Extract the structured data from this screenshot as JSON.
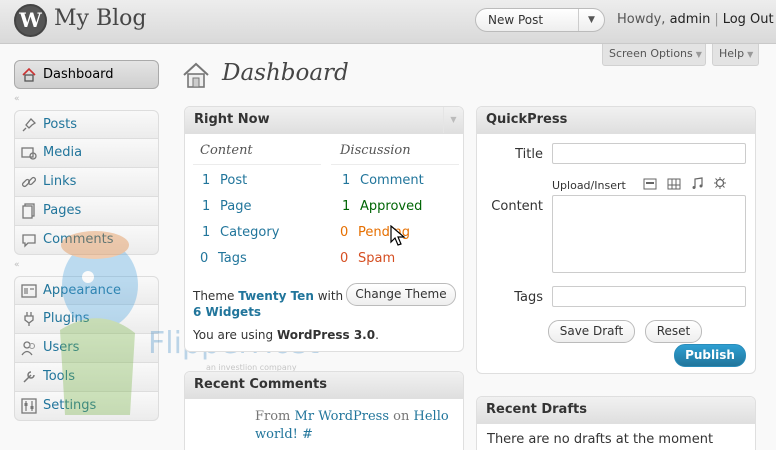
{
  "header": {
    "site_title": "My Blog",
    "logo_letter": "W",
    "favorite_action": "New Post",
    "howdy": "Howdy, ",
    "user": "admin",
    "logout": "Log Out"
  },
  "screen_meta": {
    "screen_options": "Screen Options",
    "help": "Help"
  },
  "menu": {
    "dashboard": "Dashboard",
    "group1": [
      "Posts",
      "Media",
      "Links",
      "Pages",
      "Comments"
    ],
    "group2": [
      "Appearance",
      "Plugins",
      "Users",
      "Tools",
      "Settings"
    ]
  },
  "page": {
    "title": "Dashboard"
  },
  "right_now": {
    "title": "Right Now",
    "content_head": "Content",
    "discussion_head": "Discussion",
    "content": [
      {
        "count": "1",
        "label": "Post"
      },
      {
        "count": "1",
        "label": "Page"
      },
      {
        "count": "1",
        "label": "Category"
      },
      {
        "count": "0",
        "label": "Tags"
      }
    ],
    "discussion": [
      {
        "count": "1",
        "label": "Comment"
      },
      {
        "count": "1",
        "label": "Approved"
      },
      {
        "count": "0",
        "label": "Pending"
      },
      {
        "count": "0",
        "label": "Spam"
      }
    ],
    "theme_prefix": "Theme ",
    "theme_name": "Twenty Ten",
    "theme_with": " with",
    "widgets": "6 Widgets",
    "change_theme": "Change Theme",
    "version_prefix": "You are using ",
    "version": "WordPress 3.0",
    "version_suffix": "."
  },
  "recent_comments": {
    "title": "Recent Comments",
    "from": "From ",
    "author": "Mr WordPress",
    "on": " on ",
    "post_title": "Hello world! #"
  },
  "quickpress": {
    "title": "QuickPress",
    "title_label": "Title",
    "upload_insert": "Upload/Insert",
    "content_label": "Content",
    "tags_label": "Tags",
    "save_draft": "Save Draft",
    "reset": "Reset",
    "publish": "Publish"
  },
  "recent_drafts": {
    "title": "Recent Drafts",
    "empty": "There are no drafts at the moment"
  },
  "watermark": {
    "brand": "FlipperHost",
    "tagline": "an investlion company"
  },
  "colors": {
    "link": "#21759b",
    "approved": "#006505",
    "pending": "#e66f00",
    "spam": "#d54e21"
  }
}
